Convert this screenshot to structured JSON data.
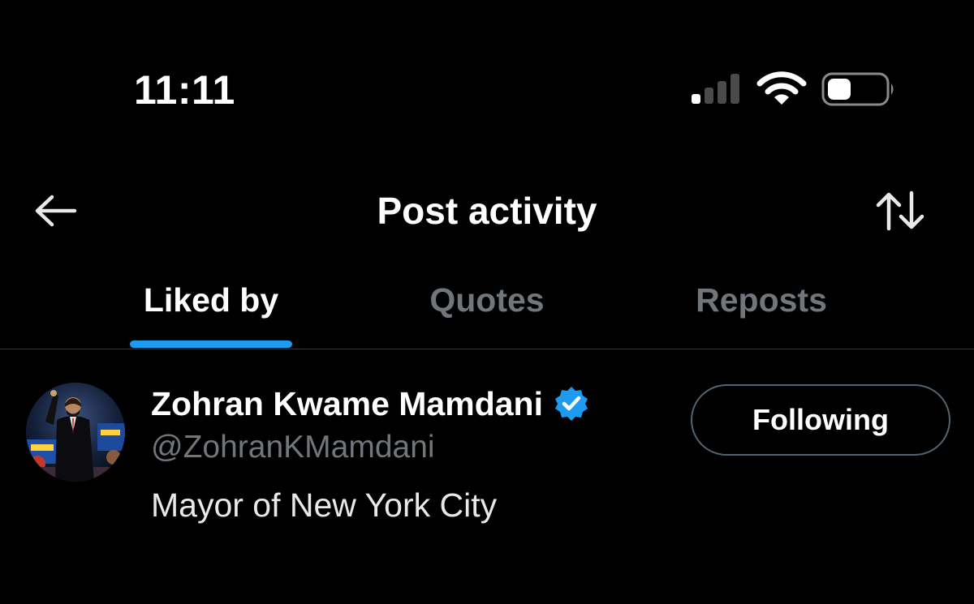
{
  "status_bar": {
    "time": "11:11",
    "signal_bars": 4,
    "signal_bars_active": 1,
    "battery_level": 0.35,
    "icons": [
      "signal-icon",
      "wifi-icon",
      "battery-icon"
    ]
  },
  "header": {
    "title": "Post activity",
    "back_icon": "arrow-left-icon",
    "sort_icon": "sort-arrows-icon"
  },
  "tabs": [
    {
      "label": "Liked by",
      "active": true
    },
    {
      "label": "Quotes",
      "active": false
    },
    {
      "label": "Reposts",
      "active": false
    }
  ],
  "users": [
    {
      "name": "Zohran Kwame Mamdani",
      "handle": "@ZohranKMamdani",
      "bio": "Mayor of New York City",
      "verified": true,
      "follow_label": "Following"
    }
  ],
  "colors": {
    "background": "#000000",
    "text_primary": "#ffffff",
    "text_secondary": "#71767b",
    "accent": "#1d9bf0",
    "divider": "#2f3336",
    "button_border": "#536471"
  }
}
